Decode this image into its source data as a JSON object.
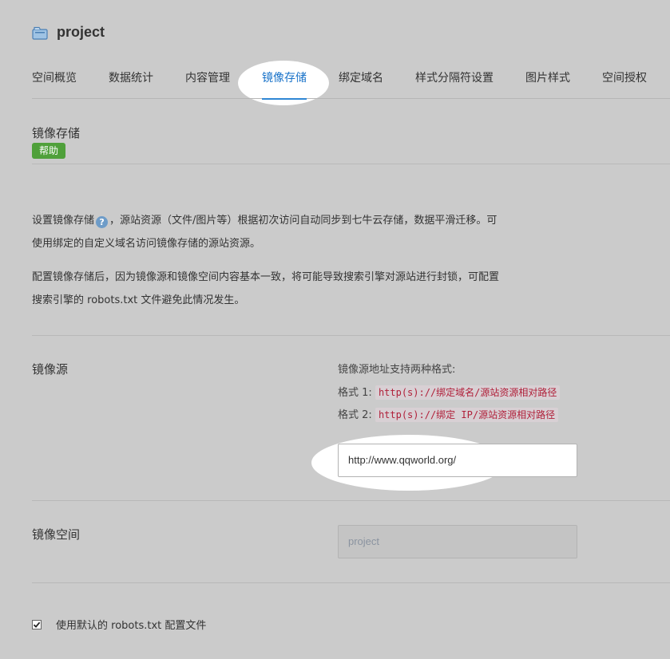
{
  "header": {
    "title": "project",
    "icon": "bucket-folder-icon"
  },
  "tabs": [
    {
      "label": "空间概览"
    },
    {
      "label": "数据统计"
    },
    {
      "label": "内容管理"
    },
    {
      "label": "镜像存储",
      "active": true
    },
    {
      "label": "绑定域名"
    },
    {
      "label": "样式分隔符设置"
    },
    {
      "label": "图片样式"
    },
    {
      "label": "空间授权"
    }
  ],
  "section": {
    "title": "镜像存储",
    "help_label": "帮助"
  },
  "description": {
    "p1_before": "设置镜像存储",
    "help_glyph": "?",
    "p1_line1_after": "，源站资源（文件/图片等）根据初次访问自动同步到七牛云存储，数据平滑迁移。可",
    "p1_line2": "使用绑定的自定义域名访问镜像存储的源站资源。",
    "p2_line1": "配置镜像存储后，因为镜像源和镜像空间内容基本一致，将可能导致搜索引擎对源站进行封锁，可配置",
    "p2_line2": "搜索引擎的 robots.txt 文件避免此情况发生。"
  },
  "mirror_source": {
    "label": "镜像源",
    "hint_title": "镜像源地址支持两种格式:",
    "format1_label": "格式 1:",
    "format1_code": "http(s)://绑定域名/源站资源相对路径",
    "format2_label": "格式 2:",
    "format2_code": "http(s)://绑定 IP/源站资源相对路径",
    "input_value": "http://www.qqworld.org/"
  },
  "mirror_bucket": {
    "label": "镜像空间",
    "input_value": "project"
  },
  "robots": {
    "checked": true,
    "label": "使用默认的 robots.txt 配置文件"
  },
  "colors": {
    "accent": "#1a73c9",
    "help_badge": "#4fa03a",
    "code_text": "#b0203a",
    "background": "#cbcbcb"
  }
}
